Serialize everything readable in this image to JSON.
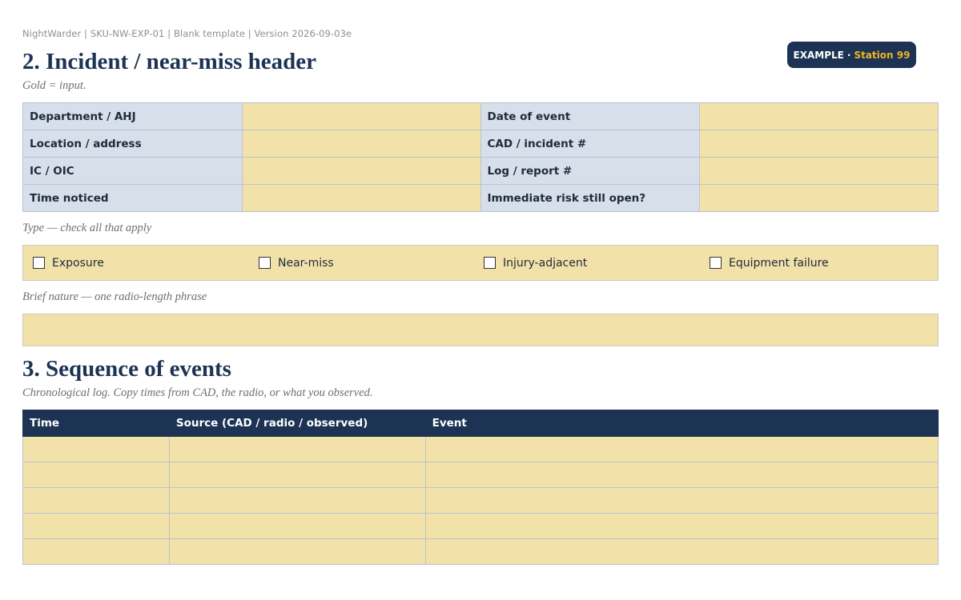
{
  "meta_line": "NightWarder | SKU-NW-EXP-01 | Blank template | Version 2026-09-03e",
  "badge": {
    "example": "EXAMPLE",
    "separator": "·",
    "station": "Station 99"
  },
  "section2": {
    "title": "2. Incident / near-miss header",
    "note": "Gold = input.",
    "rows": [
      {
        "left_label": "Department / AHJ",
        "left_value": "",
        "right_label": "Date of event",
        "right_value": ""
      },
      {
        "left_label": "Location / address",
        "left_value": "",
        "right_label": "CAD / incident #",
        "right_value": ""
      },
      {
        "left_label": "IC / OIC",
        "left_value": "",
        "right_label": "Log / report #",
        "right_value": ""
      },
      {
        "left_label": "Time noticed",
        "left_value": "",
        "right_label": "Immediate risk still open?",
        "right_value": ""
      }
    ],
    "type_note": "Type — check all that apply",
    "types": [
      {
        "label": "Exposure",
        "checked": false
      },
      {
        "label": "Near-miss",
        "checked": false
      },
      {
        "label": "Injury-adjacent",
        "checked": false
      },
      {
        "label": "Equipment failure",
        "checked": false
      }
    ],
    "nature_note": "Brief nature — one radio-length phrase",
    "nature_value": ""
  },
  "section3": {
    "title": "3. Sequence of events",
    "note": "Chronological log. Copy times from CAD, the radio, or what you observed.",
    "columns": [
      "Time",
      "Source (CAD / radio / observed)",
      "Event"
    ],
    "rows": [
      [
        "",
        "",
        ""
      ],
      [
        "",
        "",
        ""
      ],
      [
        "",
        "",
        ""
      ],
      [
        "",
        "",
        ""
      ],
      [
        "",
        "",
        ""
      ]
    ]
  },
  "colors": {
    "navy": "#1c3354",
    "gold_input": "#f2e1a8",
    "label_blue": "#d6dfea",
    "badge_accent": "#f0b429"
  }
}
